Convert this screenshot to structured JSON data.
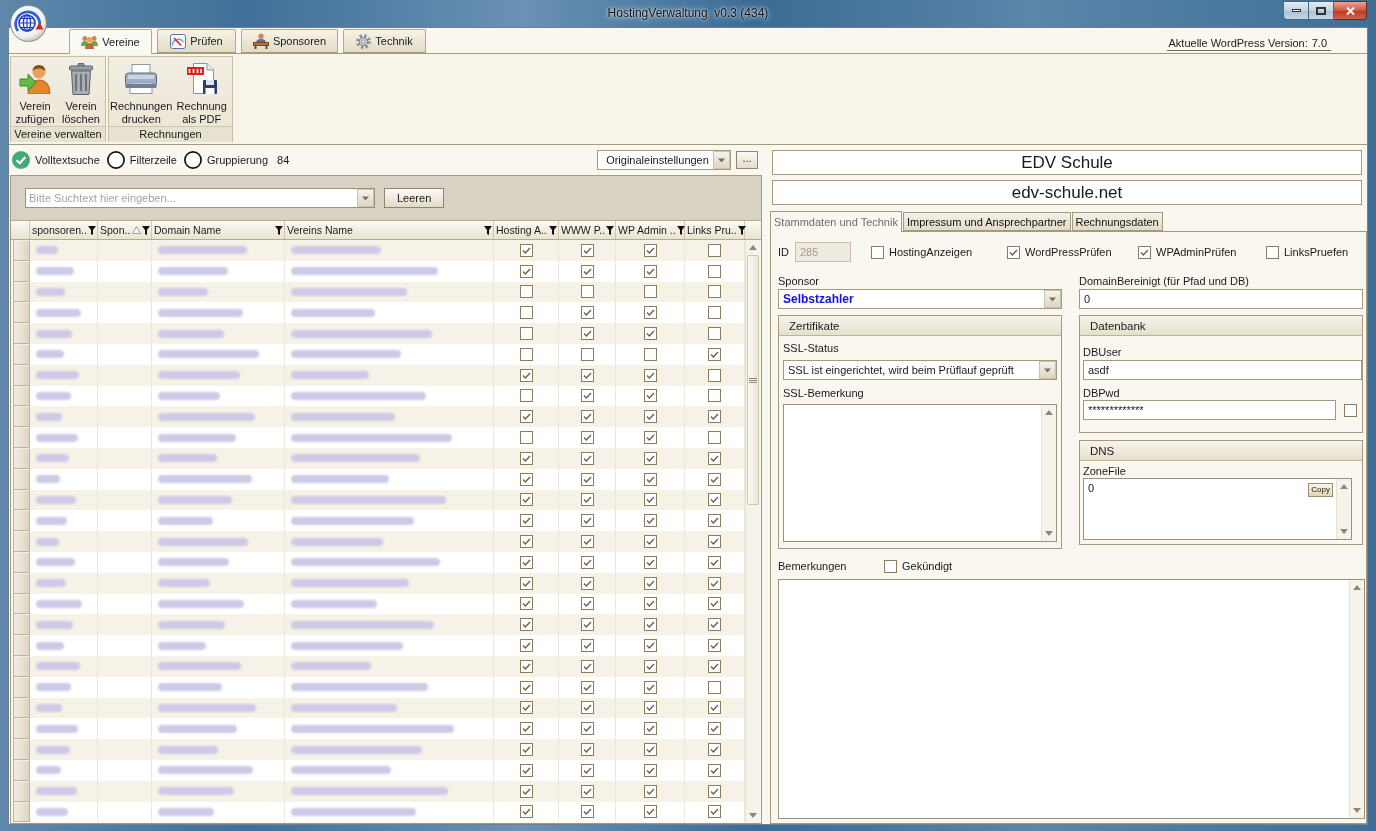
{
  "window": {
    "title": "HostingVerwaltung  v0.3 (434)"
  },
  "ribbon": {
    "tabs": [
      {
        "label": "Vereine",
        "kind": "people",
        "selected": true
      },
      {
        "label": "Prüfen",
        "kind": "gauge",
        "selected": false
      },
      {
        "label": "Sponsoren",
        "kind": "desk",
        "selected": false
      },
      {
        "label": "Technik",
        "kind": "gear",
        "selected": false
      }
    ],
    "version": {
      "label": "Aktuelle WordPress Version:",
      "value": "7.0"
    },
    "groups": [
      {
        "title": "Vereine verwalten",
        "buttons": [
          {
            "label": "Verein\nzufügen",
            "kind": "add-person"
          },
          {
            "label": "Verein\nlöschen",
            "kind": "trash"
          }
        ]
      },
      {
        "title": "Rechnungen",
        "buttons": [
          {
            "label": "Rechnungen\ndrucken",
            "kind": "printer"
          },
          {
            "label": "Rechnung\nals PDF",
            "kind": "pdf"
          }
        ]
      }
    ]
  },
  "list_panel": {
    "toggles": [
      {
        "label": "Volltextsuche",
        "checked": true
      },
      {
        "label": "Filterzeile",
        "checked": false
      },
      {
        "label": "Gruppierung",
        "checked": false
      }
    ],
    "count": "84",
    "layout_select": {
      "value": "Originaleinstellungen"
    },
    "more_button": "...",
    "search": {
      "placeholder": "Bitte Suchtext hier eingeben...",
      "clear_button": "Leeren"
    },
    "table": {
      "columns": [
        {
          "label": "sponsoren..",
          "kind": "text",
          "sorted": false,
          "blurred": true
        },
        {
          "label": "Spon..",
          "kind": "text",
          "sorted": true
        },
        {
          "label": "Domain Name",
          "kind": "text",
          "sorted": false,
          "blurred": true
        },
        {
          "label": "Vereins Name",
          "kind": "text",
          "sorted": false,
          "blurred": true
        },
        {
          "label": "Hosting A..",
          "kind": "check",
          "sorted": false
        },
        {
          "label": "WWW P..",
          "kind": "check",
          "sorted": false
        },
        {
          "label": "WP Admin ..",
          "kind": "check",
          "sorted": false
        },
        {
          "label": "Links Pru..",
          "kind": "check",
          "sorted": false
        }
      ],
      "rows": [
        {
          "checks": [
            true,
            true,
            true,
            false
          ]
        },
        {
          "checks": [
            true,
            true,
            true,
            false
          ]
        },
        {
          "checks": [
            false,
            false,
            false,
            false
          ]
        },
        {
          "checks": [
            false,
            true,
            true,
            false
          ]
        },
        {
          "checks": [
            false,
            true,
            true,
            false
          ]
        },
        {
          "checks": [
            false,
            false,
            false,
            true
          ]
        },
        {
          "checks": [
            true,
            true,
            true,
            false
          ]
        },
        {
          "checks": [
            false,
            true,
            true,
            false
          ]
        },
        {
          "checks": [
            true,
            true,
            true,
            true
          ]
        },
        {
          "checks": [
            false,
            true,
            true,
            false
          ]
        },
        {
          "checks": [
            true,
            true,
            true,
            true
          ]
        },
        {
          "checks": [
            true,
            true,
            true,
            true
          ]
        },
        {
          "checks": [
            true,
            true,
            true,
            true
          ]
        },
        {
          "checks": [
            true,
            true,
            true,
            true
          ]
        },
        {
          "checks": [
            true,
            true,
            true,
            true
          ]
        },
        {
          "checks": [
            true,
            true,
            true,
            true
          ]
        },
        {
          "checks": [
            true,
            true,
            true,
            true
          ]
        },
        {
          "checks": [
            true,
            true,
            true,
            true
          ]
        },
        {
          "checks": [
            true,
            true,
            true,
            true
          ]
        },
        {
          "checks": [
            true,
            true,
            true,
            true
          ]
        },
        {
          "checks": [
            true,
            true,
            true,
            true
          ]
        },
        {
          "checks": [
            true,
            true,
            true,
            false
          ]
        },
        {
          "checks": [
            true,
            true,
            true,
            true
          ]
        },
        {
          "checks": [
            true,
            true,
            true,
            true
          ]
        },
        {
          "checks": [
            true,
            true,
            true,
            true
          ]
        },
        {
          "checks": [
            true,
            true,
            true,
            true
          ]
        },
        {
          "checks": [
            true,
            true,
            true,
            true
          ]
        },
        {
          "checks": [
            true,
            true,
            true,
            true
          ]
        }
      ]
    }
  },
  "detail": {
    "title": "EDV Schule",
    "domain": "edv-schule.net",
    "tabs": [
      {
        "label": "Stammdaten und Technik",
        "selected": true
      },
      {
        "label": "Impressum und Ansprechpartner",
        "selected": false
      },
      {
        "label": "Rechnungsdaten",
        "selected": false
      }
    ],
    "id": {
      "label": "ID",
      "value": "285",
      "disabled": true
    },
    "flags": [
      {
        "label": "HostingAnzeigen",
        "checked": false
      },
      {
        "label": "WordPressPrüfen",
        "checked": true
      },
      {
        "label": "WPAdminPrüfen",
        "checked": true
      },
      {
        "label": "LinksPruefen",
        "checked": false
      }
    ],
    "sponsor": {
      "label": "Sponsor",
      "value": "Selbstzahler"
    },
    "domain_clean": {
      "label": "DomainBereinigt (für Pfad und DB)",
      "value": "0"
    },
    "certificates": {
      "title": "Zertifikate",
      "ssl_status": {
        "label": "SSL-Status",
        "value": "SSL ist eingerichtet, wird beim Prüflauf geprüft"
      },
      "ssl_note": {
        "label": "SSL-Bemerkung"
      }
    },
    "database": {
      "title": "Datenbank",
      "user": {
        "label": "DBUser",
        "value": "asdf"
      },
      "password": {
        "label": "DBPwd",
        "value": "*************"
      },
      "show_password": {
        "checked": false
      }
    },
    "dns": {
      "title": "DNS",
      "zone_file": {
        "label": "ZoneFile",
        "value": "0"
      },
      "copy_button": "Copy"
    },
    "notes": {
      "label": "Bemerkungen"
    },
    "cancelled": {
      "label": "Gekündigt",
      "checked": false
    }
  }
}
